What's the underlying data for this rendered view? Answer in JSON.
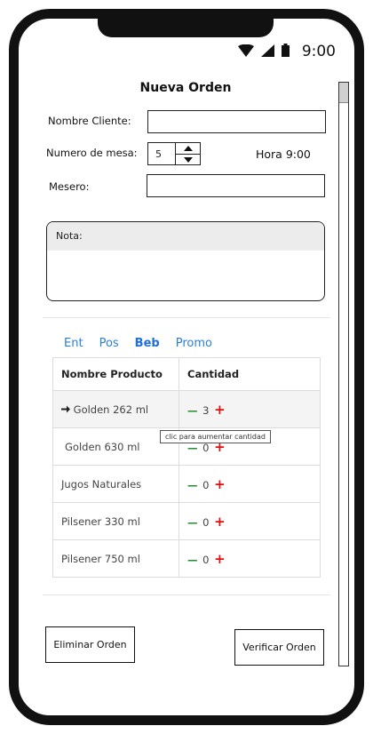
{
  "status": {
    "time": "9:00"
  },
  "form": {
    "title": "Nueva Orden",
    "cliente_label": "Nombre Cliente:",
    "cliente_value": "",
    "mesa_label": "Numero de mesa:",
    "mesa_value": "5",
    "hora": "Hora 9:00",
    "mesero_label": "Mesero:",
    "mesero_value": ""
  },
  "note": {
    "label": "Nota:",
    "value": ""
  },
  "tabs": [
    {
      "label": "Ent"
    },
    {
      "label": "Pos"
    },
    {
      "label": "Beb"
    },
    {
      "label": "Promo"
    }
  ],
  "table": {
    "headers": [
      "Nombre Producto",
      "Cantidad"
    ],
    "rows": [
      {
        "name": "Golden 262 ml",
        "qty": "3"
      },
      {
        "name": "Golden 630 ml",
        "qty": "0"
      },
      {
        "name": "Jugos Naturales",
        "qty": "0"
      },
      {
        "name": "Pilsener 330 ml",
        "qty": "0"
      },
      {
        "name": "Pilsener 750 ml",
        "qty": "0"
      }
    ]
  },
  "tooltip": "clic para aumentar cantidad",
  "buttons": {
    "delete": "Eliminar Orden",
    "verify": "Verificar Orden"
  }
}
